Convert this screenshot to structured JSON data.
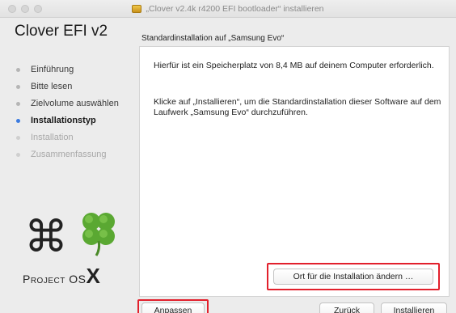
{
  "window": {
    "title": "„Clover v2.4k r4200 EFI bootloader“ installieren",
    "title_icon": "package-icon"
  },
  "sidebar": {
    "app_title": "Clover EFI v2",
    "steps": [
      {
        "label": "Einführung",
        "state": "done"
      },
      {
        "label": "Bitte lesen",
        "state": "done"
      },
      {
        "label": "Zielvolume auswählen",
        "state": "done"
      },
      {
        "label": "Installationstyp",
        "state": "active"
      },
      {
        "label": "Installation",
        "state": "pending"
      },
      {
        "label": "Zusammenfassung",
        "state": "pending"
      }
    ],
    "logo": {
      "symbol": "⌘",
      "text": "Project OS",
      "text_x": "X"
    }
  },
  "main": {
    "section_title": "Standardinstallation auf „Samsung Evo“",
    "paragraph1": "Hierfür ist ein Speicherplatz von 8,4 MB auf deinem Computer erforderlich.",
    "paragraph2": "Klicke auf „Installieren“, um die Standardinstallation dieser Software auf dem Laufwerk „Samsung Evo“ durchzuführen.",
    "change_location_label": "Ort für die Installation ändern …"
  },
  "footer": {
    "customize_label": "Anpassen",
    "back_label": "Zurück",
    "install_label": "Installieren"
  },
  "colors": {
    "highlight": "#e2202c",
    "active_step_dot": "#3b7be0",
    "clover_green": "#5aa832"
  }
}
